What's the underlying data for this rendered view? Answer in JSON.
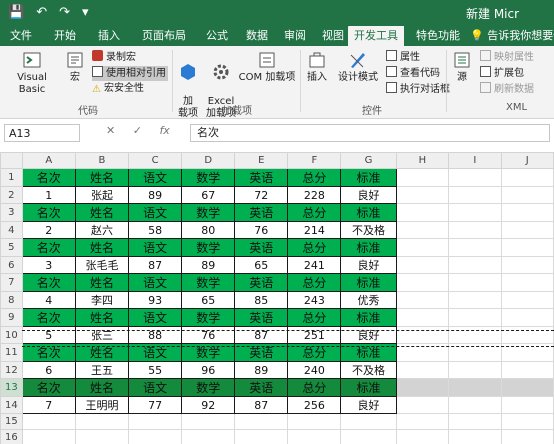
{
  "window": {
    "title": "新建 Micr"
  },
  "quick_access": {
    "save": "💾",
    "undo": "↶",
    "redo": "↷",
    "more": "▾"
  },
  "tabs": [
    "文件",
    "开始",
    "插入",
    "页面布局",
    "公式",
    "数据",
    "审阅",
    "视图",
    "开发工具",
    "特色功能"
  ],
  "active_tab": "开发工具",
  "tell_me": "告诉我你想要做什",
  "ribbon": {
    "code": {
      "label": "代码",
      "visual_basic": "Visual Basic",
      "macros": "宏",
      "record_macro": "录制宏",
      "relative_refs": "使用相对引用",
      "macro_security": "宏安全性"
    },
    "addins": {
      "label": "加载项",
      "addins": "加\n载项",
      "excel_addins": "Excel\n加载项",
      "com_addins": "COM 加载项"
    },
    "controls": {
      "label": "控件",
      "insert": "插入",
      "design_mode": "设计模式",
      "properties": "属性",
      "view_code": "查看代码",
      "run_dialog": "执行对话框"
    },
    "xml": {
      "label": "XML",
      "source": "源",
      "map_properties": "映射属性",
      "expansion_packs": "扩展包",
      "refresh_data": "刷新数据"
    }
  },
  "formula_bar": {
    "cell_ref": "A13",
    "cancel": "✕",
    "enter": "✓",
    "fx": "fx",
    "content": "名次"
  },
  "columns": [
    "A",
    "B",
    "C",
    "D",
    "E",
    "F",
    "G",
    "H",
    "I",
    "J"
  ],
  "header_labels": [
    "名次",
    "姓名",
    "语文",
    "数学",
    "英语",
    "总分",
    "标准"
  ],
  "rows": [
    {
      "num": "1",
      "type": "hdr"
    },
    {
      "num": "2",
      "type": "dat",
      "cells": [
        "1",
        "张起",
        "89",
        "67",
        "72",
        "228",
        "良好"
      ]
    },
    {
      "num": "3",
      "type": "hdr"
    },
    {
      "num": "4",
      "type": "dat",
      "cells": [
        "2",
        "赵六",
        "58",
        "80",
        "76",
        "214",
        "不及格"
      ]
    },
    {
      "num": "5",
      "type": "hdr"
    },
    {
      "num": "6",
      "type": "dat",
      "cells": [
        "3",
        "张毛毛",
        "87",
        "89",
        "65",
        "241",
        "良好"
      ]
    },
    {
      "num": "7",
      "type": "hdr"
    },
    {
      "num": "8",
      "type": "dat",
      "cells": [
        "4",
        "李四",
        "93",
        "65",
        "85",
        "243",
        "优秀"
      ]
    },
    {
      "num": "9",
      "type": "hdr"
    },
    {
      "num": "10",
      "type": "dat",
      "cells": [
        "5",
        "张三",
        "88",
        "76",
        "87",
        "251",
        "良好"
      ]
    },
    {
      "num": "11",
      "type": "hdr"
    },
    {
      "num": "12",
      "type": "dat",
      "cells": [
        "6",
        "王五",
        "55",
        "96",
        "89",
        "240",
        "不及格"
      ]
    },
    {
      "num": "13",
      "type": "hdr",
      "selected": true
    },
    {
      "num": "14",
      "type": "dat",
      "cells": [
        "7",
        "王明明",
        "77",
        "92",
        "87",
        "256",
        "良好"
      ]
    },
    {
      "num": "15",
      "type": "empty"
    },
    {
      "num": "16",
      "type": "empty"
    }
  ],
  "colors": {
    "brand": "#217346",
    "header_fill": "#00b050",
    "selected_fill": "#148a3d"
  }
}
